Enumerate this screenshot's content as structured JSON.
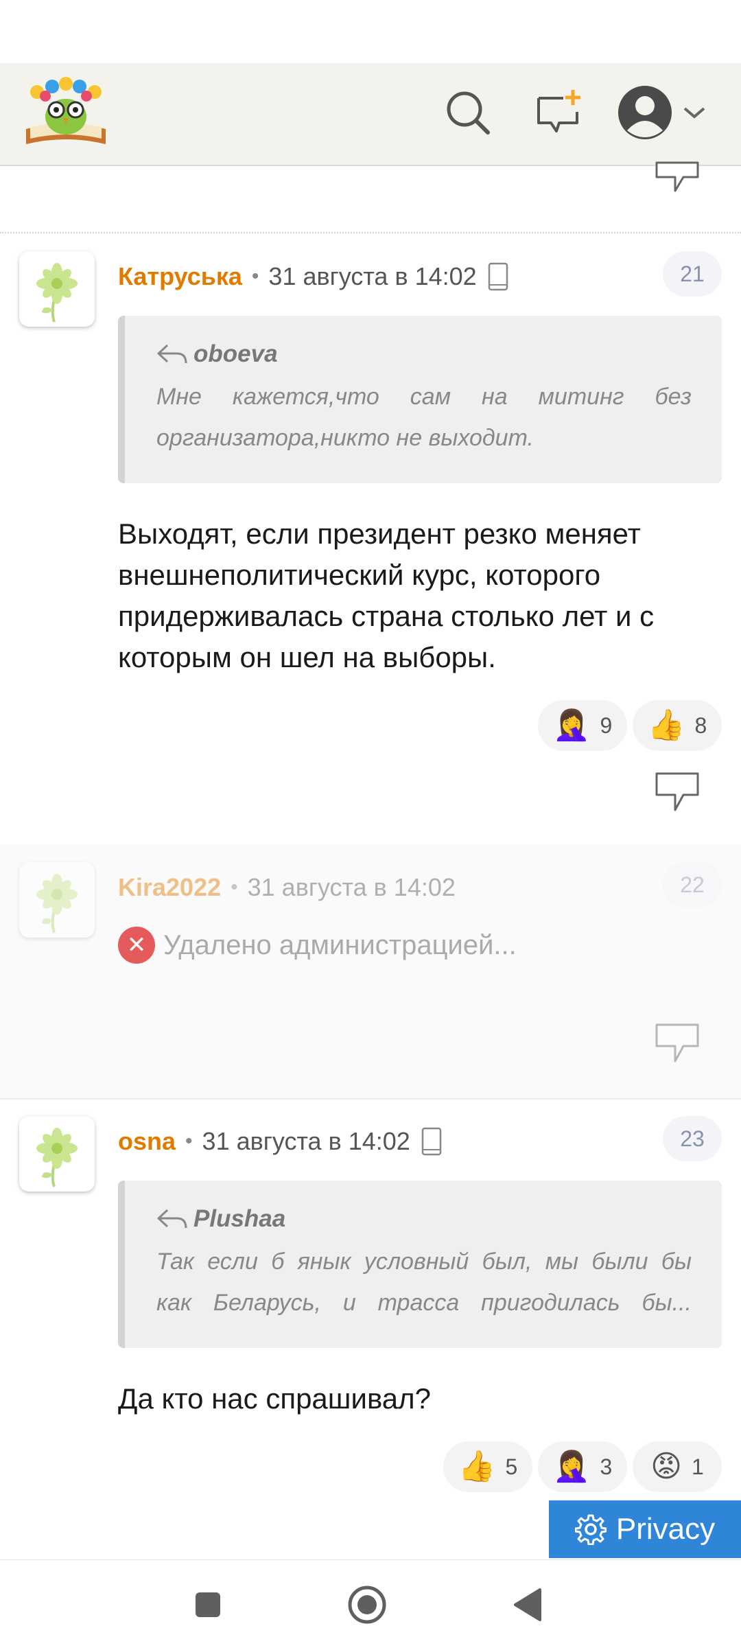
{
  "colors": {
    "header_bg": "#f3f2ed",
    "author": "#e07b00",
    "privacy_bg": "#2f86d8",
    "deleted_icon": "#e55b5b"
  },
  "header": {
    "logo_icon": "owl-reading-book-logo",
    "search_icon": "search-icon",
    "new_topic_icon": "add-message-icon",
    "profile_icon": "user-avatar-icon"
  },
  "comments": [
    {
      "author": "Катруська",
      "date": "31 августа в 14:02",
      "number": "21",
      "device": "mobile",
      "quote": {
        "author": "oboeva",
        "text_line1": "Мне кажется,что сам на митинг без",
        "text_line2": "организатора,никто не выходит."
      },
      "body_line1": "Выходят, если президент резко меняет",
      "body_line2": "внешнеполитический курс, которого",
      "body_line3": "придерживалась страна столько лет и с",
      "body_line4": "которым он шел на выборы.",
      "reactions": [
        {
          "emoji": "🤦‍♀️",
          "count": "9"
        },
        {
          "emoji": "👍",
          "count": "8"
        }
      ]
    },
    {
      "author": "Kira2022",
      "date": "31 августа в 14:02",
      "number": "22",
      "deleted_text": "Удалено администрацией..."
    },
    {
      "author": "osna",
      "date": "31 августа в 14:02",
      "number": "23",
      "device": "mobile",
      "quote": {
        "author": "Plushaa",
        "text_line1": "Так если б янык условный был, мы были бы",
        "text_line2": "как Беларусь, и трасса пригодилась бы..."
      },
      "body_line1": "Да кто нас спрашивал?",
      "reactions": [
        {
          "emoji": "👍",
          "count": "5"
        },
        {
          "emoji": "🤦‍♀️",
          "count": "3"
        },
        {
          "emoji": "😡",
          "count": "1"
        }
      ]
    }
  ],
  "privacy": {
    "label": "Privacy"
  },
  "nav": {
    "recents": "square-icon",
    "home": "circle-icon",
    "back": "triangle-back-icon"
  }
}
